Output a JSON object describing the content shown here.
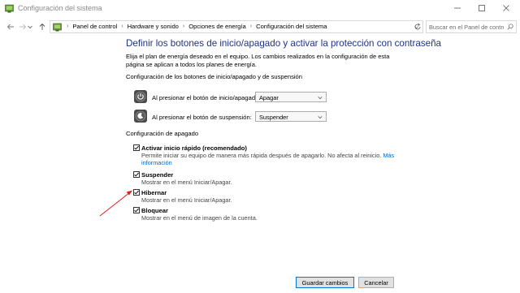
{
  "window": {
    "title": "Configuración del sistema"
  },
  "nav": {
    "crumbs": [
      "Panel de control",
      "Hardware y sonido",
      "Opciones de energía",
      "Configuración del sistema"
    ],
    "search_placeholder": "Buscar en el Panel de control"
  },
  "main": {
    "heading": "Definir los botones de inicio/apagado y activar la protección con contraseña",
    "description": "Elija el plan de energía deseado en el equipo. Los cambios realizados en la configuración de esta página se aplican a todos los planes de energía.",
    "buttons_section": "Configuración de los botones de inicio/apagado y de suspensión",
    "power_button_label": "Al presionar el botón de inicio/apagado:",
    "power_button_value": "Apagar",
    "sleep_button_label": "Al presionar el botón de suspensión:",
    "sleep_button_value": "Suspender",
    "shutdown_section": "Configuración de apagado",
    "options": [
      {
        "label": "Activar inicio rápido (recomendado)",
        "desc": "Permite iniciar su equipo de manera más rápida después de apagarlo. No afecta al reinicio.",
        "link1": "Más",
        "link2": "información",
        "checked": true
      },
      {
        "label": "Suspender",
        "desc": "Mostrar en el menú Iniciar/Apagar.",
        "checked": true
      },
      {
        "label": "Hibernar",
        "desc": "Mostrar en el menú Iniciar/Apagar.",
        "checked": true
      },
      {
        "label": "Bloquear",
        "desc": "Mostrar en el menú de imagen de la cuenta.",
        "checked": true
      }
    ]
  },
  "footer": {
    "save_label": "Guardar cambios",
    "cancel_label": "Cancelar"
  },
  "colors": {
    "heading": "#1e3287",
    "link": "#0066cc",
    "annotation_arrow": "#e02020"
  },
  "icons": [
    "control-panel-icon",
    "minimize-icon",
    "maximize-icon",
    "close-icon",
    "back-arrow-icon",
    "forward-arrow-icon",
    "recent-dropdown-icon",
    "up-arrow-icon",
    "refresh-icon",
    "search-icon",
    "power-button-icon",
    "sleep-button-icon",
    "checkmark-icon"
  ]
}
